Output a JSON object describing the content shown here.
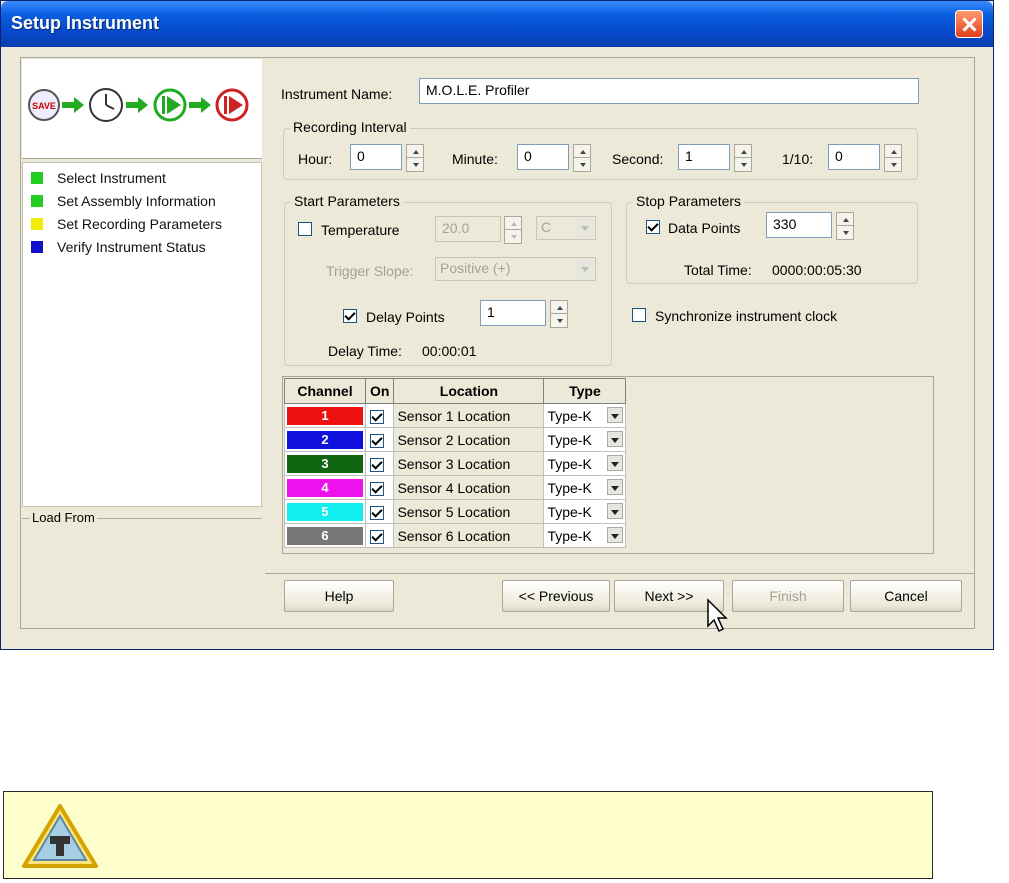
{
  "window": {
    "title": "Setup Instrument"
  },
  "steps": [
    {
      "label": "Select Instrument",
      "color": "#22cc22"
    },
    {
      "label": "Set Assembly Information",
      "color": "#22cc22"
    },
    {
      "label": "Set Recording Parameters",
      "color": "#eeee00"
    },
    {
      "label": "Verify Instrument Status",
      "color": "#1111cc"
    }
  ],
  "wizard_graphic": {
    "start_label": "SAVE"
  },
  "load_from": {
    "legend": "Load From"
  },
  "instrument": {
    "label": "Instrument Name:",
    "value": "M.O.L.E. Profiler"
  },
  "recording_interval": {
    "legend": "Recording Interval",
    "hour_label": "Hour:",
    "hour_value": "0",
    "minute_label": "Minute:",
    "minute_value": "0",
    "second_label": "Second:",
    "second_value": "1",
    "tenth_label": "1/10:",
    "tenth_value": "0"
  },
  "start_parameters": {
    "legend": "Start Parameters",
    "temperature_label": "Temperature",
    "temperature_value": "20.0",
    "temperature_unit": "C",
    "trigger_label": "Trigger Slope:",
    "trigger_value": "Positive (+)",
    "delay_points_label": "Delay Points",
    "delay_points_value": "1",
    "delay_time_label": "Delay Time:",
    "delay_time_value": "00:00:01"
  },
  "stop_parameters": {
    "legend": "Stop Parameters",
    "data_points_label": "Data Points",
    "data_points_value": "330",
    "total_time_label": "Total Time:",
    "total_time_value": "0000:00:05:30"
  },
  "sync_label": "Synchronize instrument clock",
  "channel_table": {
    "headers": [
      "Channel",
      "On",
      "Location",
      "Type"
    ],
    "rows": [
      {
        "channel": "1",
        "color": "#ee1111",
        "location": "Sensor 1 Location",
        "type": "Type-K"
      },
      {
        "channel": "2",
        "color": "#1111dd",
        "location": "Sensor 2 Location",
        "type": "Type-K"
      },
      {
        "channel": "3",
        "color": "#116611",
        "location": "Sensor 3 Location",
        "type": "Type-K"
      },
      {
        "channel": "4",
        "color": "#ee11ee",
        "location": "Sensor 4 Location",
        "type": "Type-K"
      },
      {
        "channel": "5",
        "color": "#11eeee",
        "location": "Sensor 5 Location",
        "type": "Type-K"
      },
      {
        "channel": "6",
        "color": "#777777",
        "location": "Sensor 6 Location",
        "type": "Type-K"
      }
    ]
  },
  "buttons": {
    "help": "Help",
    "previous": "<< Previous",
    "next": "Next >>",
    "finish": "Finish",
    "cancel": "Cancel"
  }
}
